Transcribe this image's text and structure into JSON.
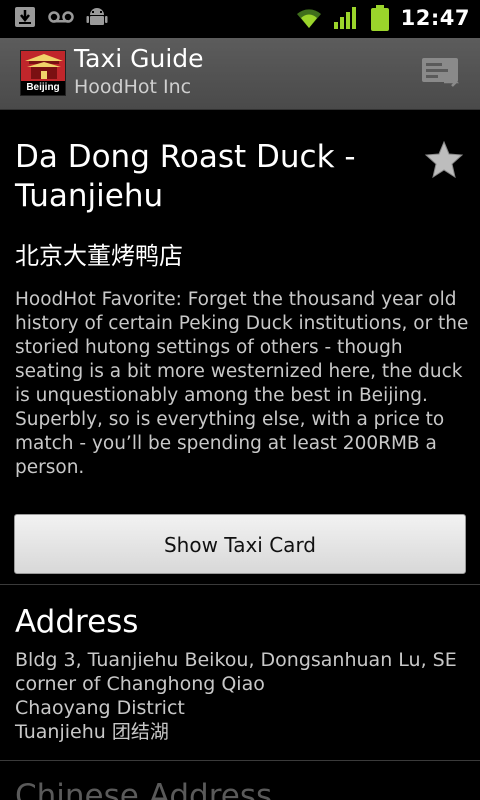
{
  "status_bar": {
    "time": "12:47",
    "icons": [
      "download-icon",
      "voicemail-icon",
      "android-icon",
      "wifi-icon",
      "signal-icon",
      "battery-icon"
    ]
  },
  "action_bar": {
    "title": "Taxi Guide",
    "subtitle": "HoodHot Inc",
    "logo_caption": "Beijing",
    "action_icon": "taxi-card-icon"
  },
  "place": {
    "name": "Da Dong Roast Duck - Tuanjiehu",
    "chinese_name": "北京大董烤鸭店",
    "description": "HoodHot Favorite:  Forget the thousand year old history of certain Peking Duck institutions, or the storied hutong settings of others - though seating is a bit more westernized here, the duck is unquestionably among the best in Beijing. Superbly, so is everything else, with a price to match - you’ll be spending at least 200RMB a person.",
    "favorite_icon": "star-icon"
  },
  "taxi_button": {
    "label": "Show Taxi Card"
  },
  "address": {
    "heading": "Address",
    "lines": [
      "Bldg 3, Tuanjiehu Beikou, Dongsanhuan Lu, SE",
      "corner of Changhong Qiao",
      "Chaoyang District",
      "Tuanjiehu 团结湖"
    ]
  },
  "chinese_address": {
    "heading": "Chinese Address"
  },
  "colors": {
    "background": "#000000",
    "action_bar": "#535353",
    "button": "#e6e6e6",
    "logo_red": "#c0262b"
  }
}
